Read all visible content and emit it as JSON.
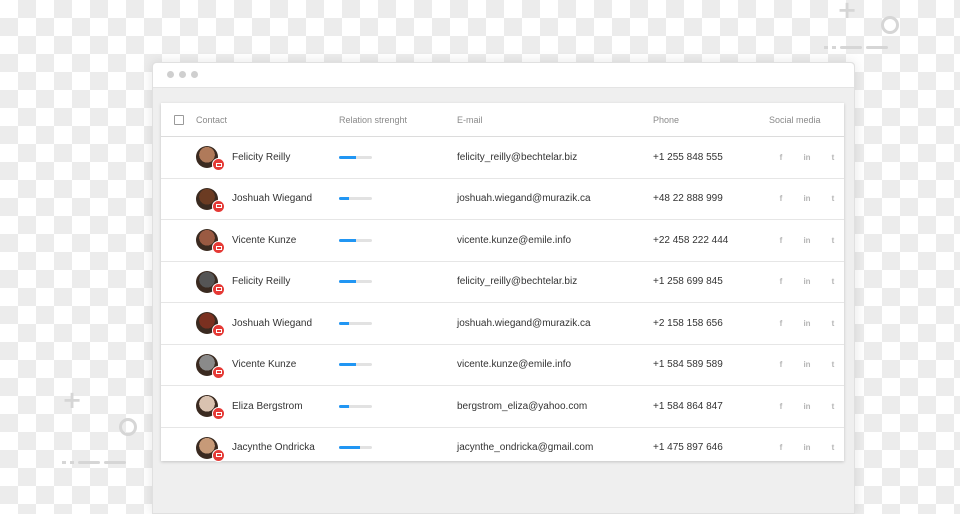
{
  "window": {
    "title": ""
  },
  "table": {
    "headers": {
      "contact": "Contact",
      "relation": "Relation strenght",
      "email": "E-mail",
      "phone": "Phone",
      "social": "Social media"
    },
    "social_icons": {
      "facebook": "f",
      "linkedin": "in",
      "twitter": "t"
    },
    "rows": [
      {
        "name": "Felicity Reilly",
        "relation": 0.5,
        "email": "felicity_reilly@bechtelar.biz",
        "phone": "+1 255 848 555",
        "avatar_color": "#b07a5a"
      },
      {
        "name": "Joshuah Wiegand",
        "relation": 0.3,
        "email": "joshuah.wiegand@murazik.ca",
        "phone": "+48 22 888 999",
        "avatar_color": "#6b3b22"
      },
      {
        "name": "Vicente Kunze",
        "relation": 0.5,
        "email": "vicente.kunze@emile.info",
        "phone": "+22 458 222 444",
        "avatar_color": "#9a5a42"
      },
      {
        "name": "Felicity Reilly",
        "relation": 0.5,
        "email": "felicity_reilly@bechtelar.biz",
        "phone": "+1 258 699 845",
        "avatar_color": "#555555"
      },
      {
        "name": "Joshuah Wiegand",
        "relation": 0.3,
        "email": "joshuah.wiegand@murazik.ca",
        "phone": "+2 158 158 656",
        "avatar_color": "#7a3020"
      },
      {
        "name": "Vicente Kunze",
        "relation": 0.5,
        "email": "vicente.kunze@emile.info",
        "phone": "+1 584 589 589",
        "avatar_color": "#8a8a8a"
      },
      {
        "name": "Eliza Bergstrom",
        "relation": 0.3,
        "email": "bergstrom_eliza@yahoo.com",
        "phone": "+1 584 864 847",
        "avatar_color": "#d9c2b0"
      },
      {
        "name": "Jacynthe Ondricka",
        "relation": 0.65,
        "email": "jacynthe_ondricka@gmail.com",
        "phone": "+1 475 897 646",
        "avatar_color": "#c79a78"
      }
    ]
  },
  "colors": {
    "accent": "#2196f3",
    "badge": "#e53935"
  }
}
